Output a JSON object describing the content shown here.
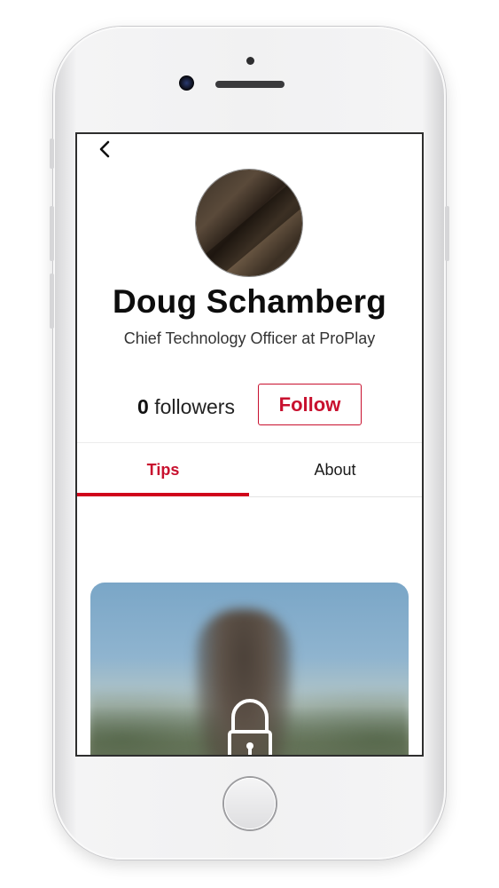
{
  "profile": {
    "name": "Doug Schamberg",
    "title": "Chief Technology Officer at ProPlay",
    "followers_count": "0",
    "followers_label": "followers",
    "follow_button": "Follow"
  },
  "tabs": [
    {
      "label": "Tips",
      "active": true
    },
    {
      "label": "About",
      "active": false
    }
  ],
  "icons": {
    "back": "chevron-left-icon",
    "lock": "lock-icon"
  },
  "colors": {
    "accent": "#c8102e",
    "text": "#0d0d0d"
  }
}
